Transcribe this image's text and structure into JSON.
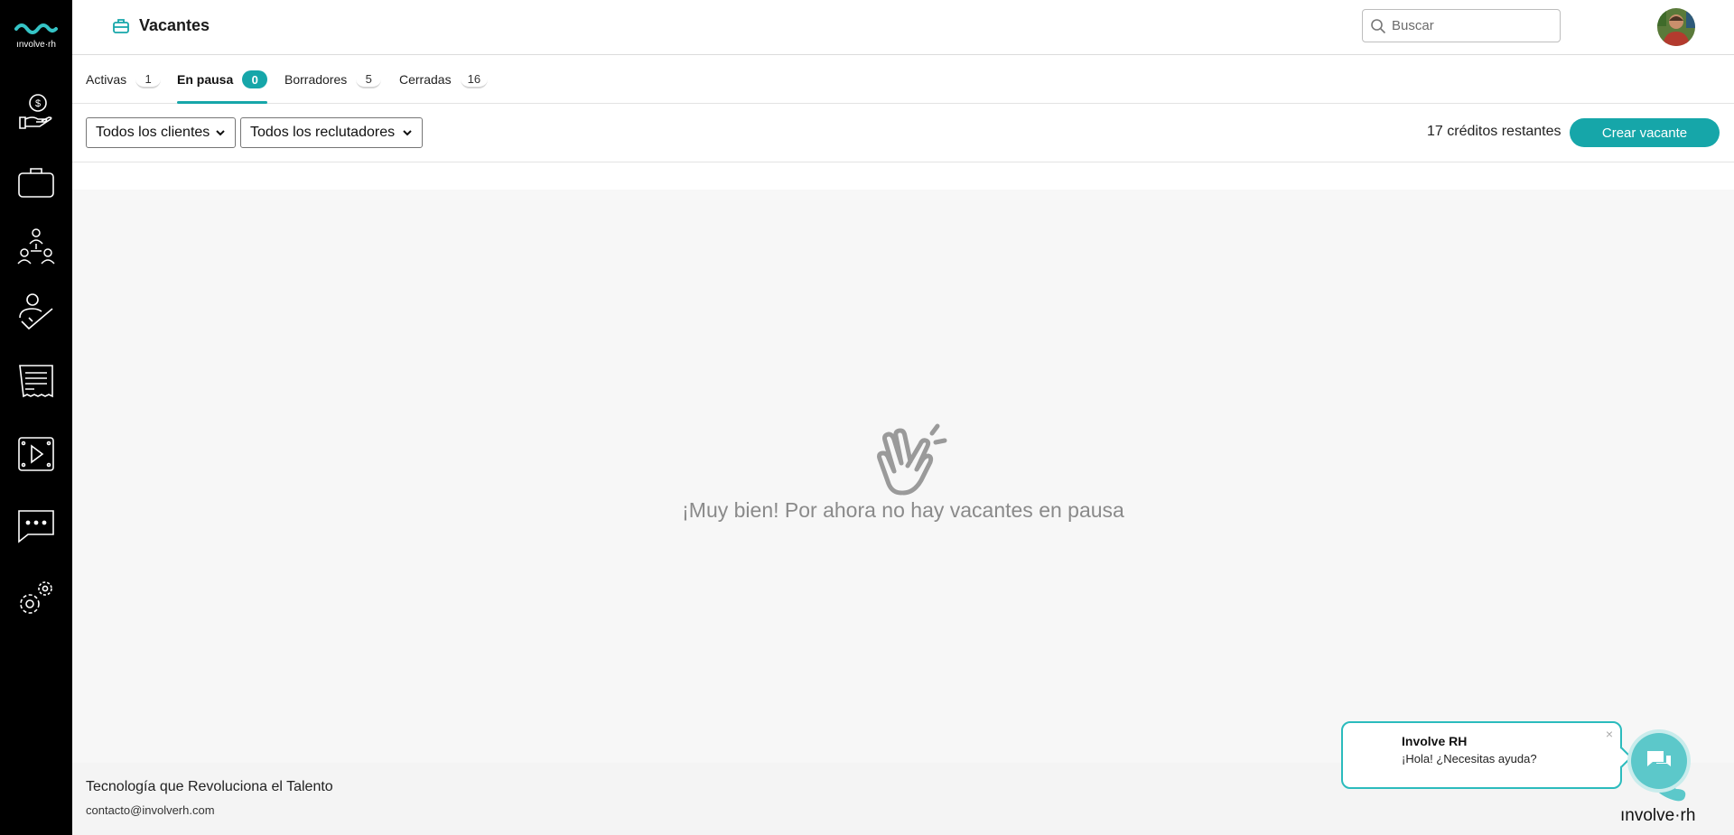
{
  "header": {
    "title": "Vacantes",
    "search_placeholder": "Buscar"
  },
  "tabs": [
    {
      "label": "Activas",
      "count": "1",
      "active": false
    },
    {
      "label": "En pausa",
      "count": "0",
      "active": true
    },
    {
      "label": "Borradores",
      "count": "5",
      "active": false
    },
    {
      "label": "Cerradas",
      "count": "16",
      "active": false
    }
  ],
  "filters": {
    "clients_selected": "Todos los clientes",
    "recruiters_selected": "Todos los reclutadores",
    "credits_text": "17 créditos restantes",
    "create_button": "Crear vacante"
  },
  "main": {
    "empty_message": "¡Muy bien! Por ahora no hay vacantes en pausa"
  },
  "footer": {
    "tagline": "Tecnología que Revoluciona el Talento",
    "email": "contacto@involverh.com"
  },
  "chat": {
    "name": "Involve RH",
    "message": "¡Hola! ¿Necesitas ayuda?",
    "close": "×"
  },
  "brand": {
    "logo_text": "ınvolve·rh",
    "accent_color": "#16a6a9"
  },
  "sidebar": {
    "icons": [
      "payments-hand-icon",
      "briefcase-icon",
      "people-network-icon",
      "candidate-check-icon",
      "invoice-icon",
      "video-film-icon",
      "chat-bubble-icon",
      "settings-gears-icon"
    ]
  }
}
